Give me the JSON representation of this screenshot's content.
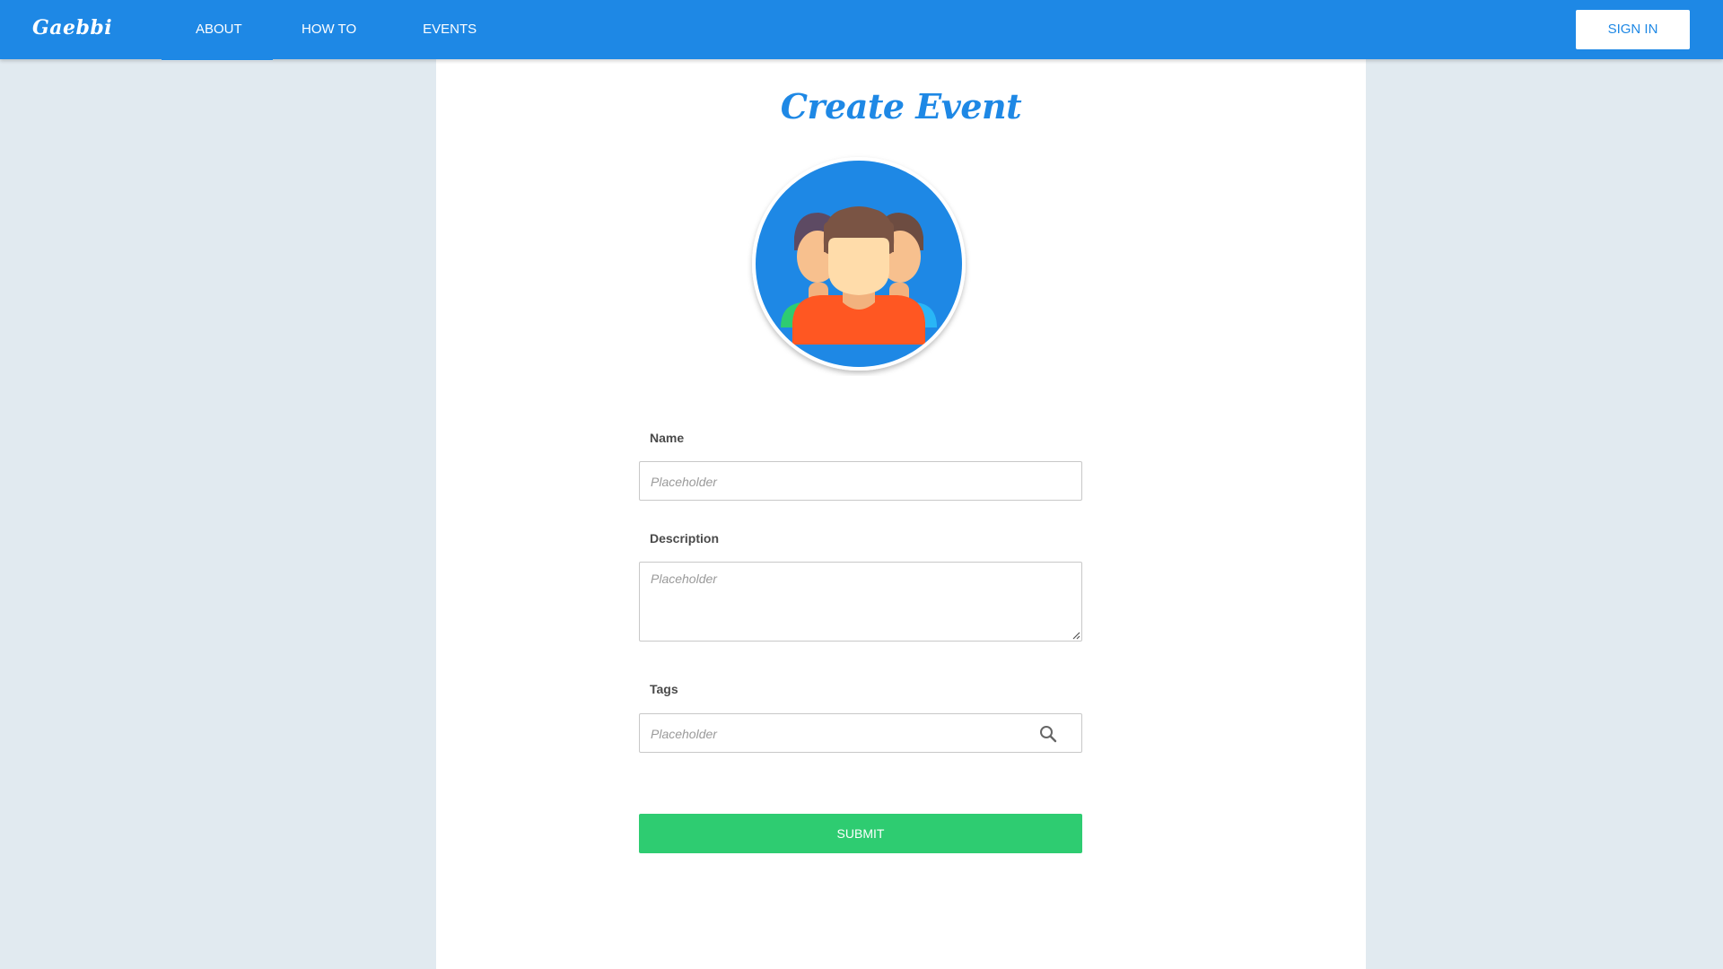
{
  "navbar": {
    "brand": "Gaebbi",
    "items": [
      {
        "label": "ABOUT",
        "active": true
      },
      {
        "label": "HOW TO",
        "active": false
      },
      {
        "label": "EVENTS",
        "active": false
      }
    ],
    "sign_in_label": "SIGN IN"
  },
  "main": {
    "title": "Create Event",
    "avatar_icon": "group-people-icon",
    "form": {
      "name_label": "Name",
      "name_placeholder": "Placeholder",
      "description_label": "Description",
      "description_placeholder": "Placeholder",
      "tags_label": "Tags",
      "tags_placeholder": "Placeholder",
      "search_icon": "search-icon",
      "submit_label": "SUBMIT"
    }
  },
  "colors": {
    "primary": "#1e88e5",
    "background": "#e1eaf0",
    "submit": "#2ecc71",
    "avatar_shirt": "#ff5722"
  }
}
